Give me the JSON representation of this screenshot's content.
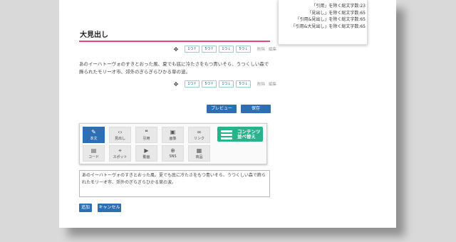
{
  "sidebar": {
    "lines": [
      "",
      "「引用」を除く総文字数:23",
      "「見出し」を除く総文字数:65",
      "「引用&見出し」を除く総文字数:65",
      "「引用&大見出し」を除く総文字数:65"
    ]
  },
  "block": {
    "heading": "大見出し",
    "controls": {
      "move_icon": "✥",
      "buttons": [
        "1つ↑",
        "5つ↑",
        "1つ↓",
        "5つ↓"
      ],
      "delete_label": "削除",
      "edit_label": "編集"
    },
    "paragraph": "あのイーハトーヴォのすきとおった風、夏でも底に冷たさをもつ青いそら、うつくしい森で飾られたモリーオ市、郊外のぎらぎらひかる草の波。"
  },
  "buttons": {
    "preview": "プレビュー",
    "save": "保存",
    "add": "追加",
    "cancel": "キャンセル"
  },
  "palette": {
    "tiles": [
      {
        "label": "本文",
        "icon": "✎",
        "icon_name": "pen-icon",
        "active": true
      },
      {
        "label": "見出し",
        "icon": "‹›",
        "icon_name": "code-bracket-icon"
      },
      {
        "label": "引用",
        "icon": "❝",
        "icon_name": "quote-icon"
      },
      {
        "label": "画像",
        "icon": "▣",
        "icon_name": "camera-icon"
      },
      {
        "label": "リンク",
        "icon": "∞",
        "icon_name": "link-icon"
      },
      {
        "label": "コード",
        "icon": "▤",
        "icon_name": "keyboard-icon"
      },
      {
        "label": "スポット",
        "icon": "⌖",
        "icon_name": "map-icon"
      },
      {
        "label": "動画",
        "icon": "▶",
        "icon_name": "video-icon"
      },
      {
        "label": "SNS",
        "icon": "⊕",
        "icon_name": "globe-icon"
      },
      {
        "label": "商品",
        "icon": "▦",
        "icon_name": "bag-icon"
      }
    ],
    "sort_label_1": "コンテンツ",
    "sort_label_2": "並べ替え"
  },
  "editor": {
    "text": "あのイーハトーヴォのすきとおった風、夏でも底に冷たさをもつ青いそら、うつくしい森で飾られたモリーオ市、郊外のぎらぎらひかる草の波。"
  },
  "colors": {
    "accent": "#2d6fb4",
    "heading_rule": "#e8447a",
    "sort_button": "#29b38c"
  }
}
